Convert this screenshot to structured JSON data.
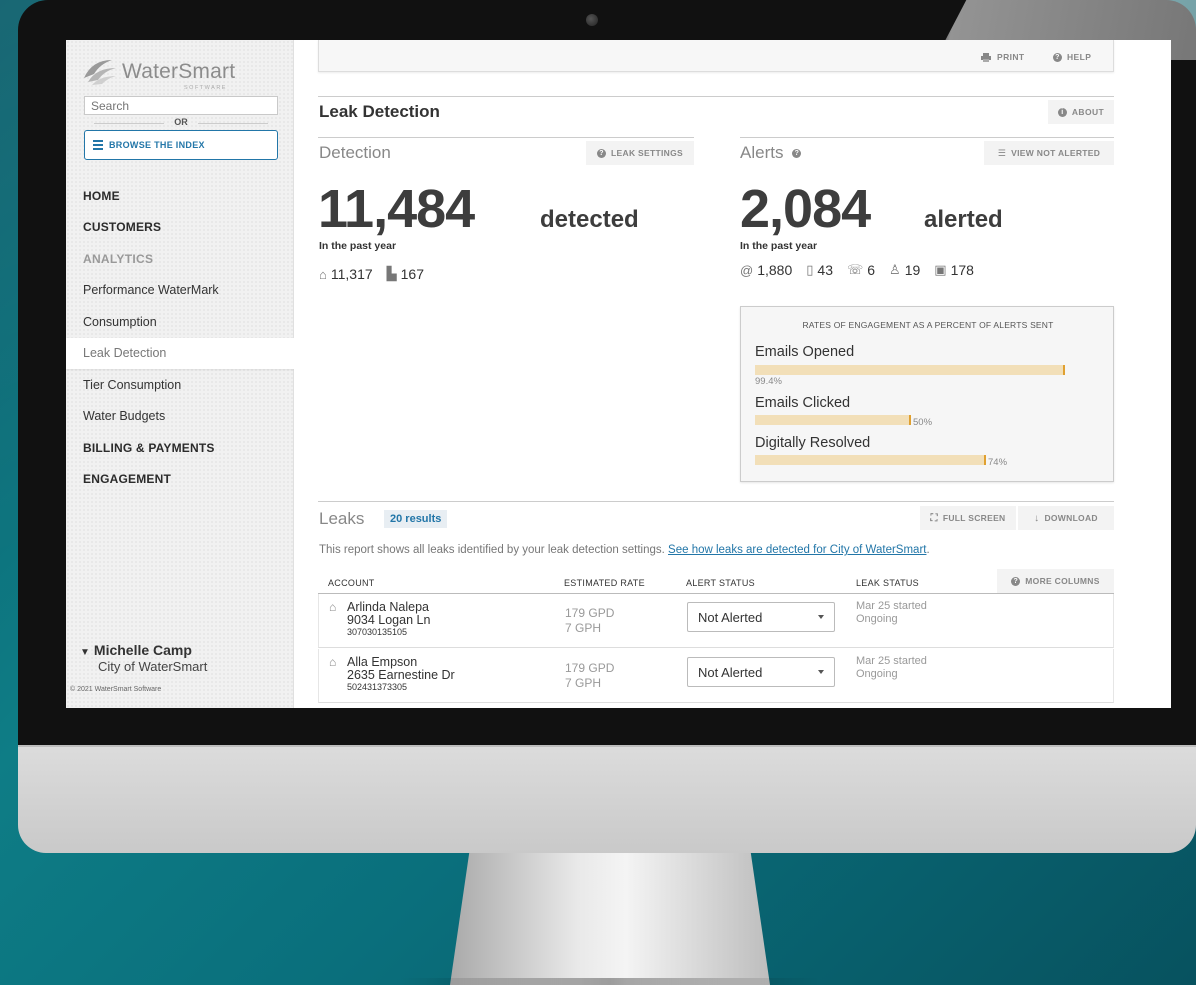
{
  "app": {
    "logo_text": "WaterSmart",
    "logo_sub": "SOFTWARE"
  },
  "sidebar": {
    "search_placeholder": "Search",
    "or_label": "OR",
    "browse_label": "BROWSE THE INDEX",
    "items": [
      {
        "label": "HOME",
        "style": "bold"
      },
      {
        "label": "CUSTOMERS",
        "style": "bold"
      },
      {
        "label": "ANALYTICS",
        "style": "muted"
      },
      {
        "label": "Performance WaterMark",
        "style": "normal"
      },
      {
        "label": "Consumption",
        "style": "normal"
      },
      {
        "label": "Leak Detection",
        "style": "active"
      },
      {
        "label": "Tier Consumption",
        "style": "normal"
      },
      {
        "label": "Water Budgets",
        "style": "normal"
      },
      {
        "label": "BILLING & PAYMENTS",
        "style": "bold"
      },
      {
        "label": "ENGAGEMENT",
        "style": "bold"
      }
    ],
    "user_name": "Michelle Camp",
    "user_org": "City of WaterSmart",
    "copyright": "© 2021 WaterSmart Software"
  },
  "toolbar": {
    "print_label": "PRINT",
    "help_label": "HELP"
  },
  "page": {
    "title": "Leak Detection",
    "about_label": "ABOUT"
  },
  "detection": {
    "heading": "Detection",
    "settings_label": "LEAK SETTINGS",
    "count": "11,484",
    "unit": "detected",
    "period": "In the past year",
    "residential": "11,317",
    "commercial": "167"
  },
  "alerts": {
    "heading": "Alerts",
    "view_label": "VIEW NOT ALERTED",
    "count": "2,084",
    "unit": "alerted",
    "period": "In the past year",
    "email": "1,880",
    "sms": "43",
    "phone": "6",
    "person": "19",
    "letter": "178"
  },
  "engagement": {
    "title": "RATES OF ENGAGEMENT AS A PERCENT OF ALERTS SENT",
    "rows": [
      {
        "label": "Emails Opened",
        "pct": "99.4%",
        "value": 99.4
      },
      {
        "label": "Emails Clicked",
        "pct": "50%",
        "value": 50
      },
      {
        "label": "Digitally Resolved",
        "pct": "74%",
        "value": 74
      }
    ]
  },
  "leaks": {
    "heading": "Leaks",
    "results": "20 results",
    "fullscreen_label": "FULL SCREEN",
    "download_label": "DOWNLOAD",
    "desc": "This report shows all leaks identified by your leak detection settings.",
    "link": "See how leaks are detected for City of WaterSmart",
    "more_columns_label": "MORE COLUMNS",
    "columns": [
      "ACCOUNT",
      "ESTIMATED RATE",
      "ALERT STATUS",
      "LEAK STATUS"
    ],
    "rows": [
      {
        "name": "Arlinda Nalepa",
        "address": "9034 Logan Ln",
        "account": "307030135105",
        "rate_gpd": "179 GPD",
        "rate_gph": "7 GPH",
        "alert_status": "Not Alerted",
        "leak_started": "Mar 25 started",
        "leak_state": "Ongoing"
      },
      {
        "name": "Alla Empson",
        "address": "2635 Earnestine Dr",
        "account": "502431373305",
        "rate_gpd": "179 GPD",
        "rate_gph": "7 GPH",
        "alert_status": "Not Alerted",
        "leak_started": "Mar 25 started",
        "leak_state": "Ongoing"
      }
    ]
  },
  "colors": {
    "accent": "#2276a8",
    "bar_fill": "#f2dfb8",
    "bar_tick": "#e0a030"
  }
}
